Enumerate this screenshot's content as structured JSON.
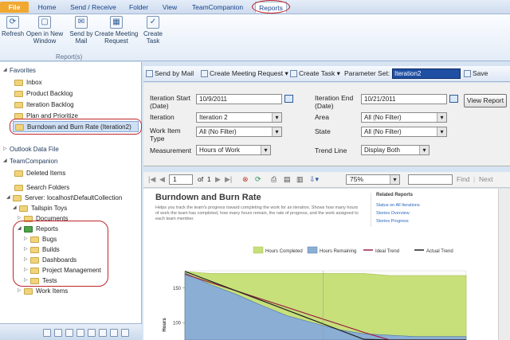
{
  "menu": {
    "tabs": [
      "File",
      "Home",
      "Send / Receive",
      "Folder",
      "View",
      "TeamCompanion",
      "Reports"
    ],
    "active": "Reports"
  },
  "ribbon": {
    "buttons": [
      "Refresh",
      "Open in New Window",
      "Send by Mail",
      "Create Meeting Request",
      "Create Task"
    ],
    "group_label": "Report(s)"
  },
  "nav": {
    "favorites": {
      "header": "Favorites",
      "items": [
        "Inbox",
        "Product Backlog",
        "Iteration Backlog",
        "Plan and Prioritize",
        "Burndown and Burn Rate (Iteration2)"
      ]
    },
    "outlook_data_file": "Outlook Data File",
    "teamcompanion": {
      "header": "TeamCompanion",
      "deleted": "Deleted Items",
      "search": "Search Folders",
      "server": "Server: localhost\\DefaultCollection",
      "project": "Tailspin Toys",
      "documents": "Documents",
      "reports": "Reports",
      "report_folders": [
        "Bugs",
        "Builds",
        "Dashboards",
        "Project Management",
        "Tests"
      ],
      "work_items": "Work Items"
    }
  },
  "toolbar": {
    "send_by_mail": "Send by Mail",
    "create_meeting": "Create Meeting Request",
    "create_task": "Create Task",
    "parameter_set_label": "Parameter Set:",
    "parameter_set_value": "Iteration2",
    "save": "Save"
  },
  "params": {
    "iteration_start_label": "Iteration Start (Date)",
    "iteration_start_value": "10/9/2011",
    "iteration_end_label": "Iteration End (Date)",
    "iteration_end_value": "10/21/2011",
    "iteration_label": "Iteration",
    "iteration_value": "Iteration 2",
    "area_label": "Area",
    "area_value": "All (No Filter)",
    "work_item_type_label": "Work Item Type",
    "work_item_type_value": "All (No Filter)",
    "state_label": "State",
    "state_value": "All (No Filter)",
    "measurement_label": "Measurement",
    "measurement_value": "Hours of Work",
    "trend_line_label": "Trend Line",
    "trend_line_value": "Display Both",
    "view_report": "View Report"
  },
  "paging": {
    "page": "1",
    "of_label": "of",
    "total": "1",
    "zoom": "75%",
    "find": "Find",
    "next": "Next"
  },
  "report": {
    "title": "Burndown and Burn Rate",
    "description": "Helps you track the team's progress toward completing the work for an iteration. Shows how many hours of work the team has completed, how many hours remain, the rate of progress, and the work assigned to each team member.",
    "related_header": "Related Reports",
    "related_links": [
      "Status on All Iterations",
      "Stories Overview",
      "Stories Progress"
    ]
  },
  "chart_data": {
    "type": "area",
    "legend": [
      "Hours Completed",
      "Hours Remaining",
      "Ideal Trend",
      "Actual Trend"
    ],
    "legend_placement": "top",
    "ylabel": "Hours",
    "yticks": [
      150,
      100
    ],
    "colors": {
      "completed": "#c7e07a",
      "remaining": "#8aaed4",
      "ideal": "#9a2040",
      "actual": "#202020"
    },
    "ylim": [
      75,
      175
    ],
    "series": [
      {
        "name": "Hours Completed",
        "values": [
          174,
          171,
          171,
          171,
          171,
          171,
          171,
          171,
          168,
          168,
          168,
          168
        ]
      },
      {
        "name": "Hours Remaining",
        "values": [
          172,
          155,
          141,
          125,
          110,
          100,
          90,
          84,
          82,
          80,
          80,
          80
        ]
      },
      {
        "name": "Ideal Trend",
        "values": [
          170,
          158,
          146,
          134,
          122,
          110,
          98,
          86,
          75,
          75,
          75,
          75
        ]
      },
      {
        "name": "Actual Trend",
        "values": [
          174,
          160,
          146,
          132,
          118,
          104,
          90,
          76,
          75,
          75,
          75,
          75
        ]
      }
    ]
  }
}
